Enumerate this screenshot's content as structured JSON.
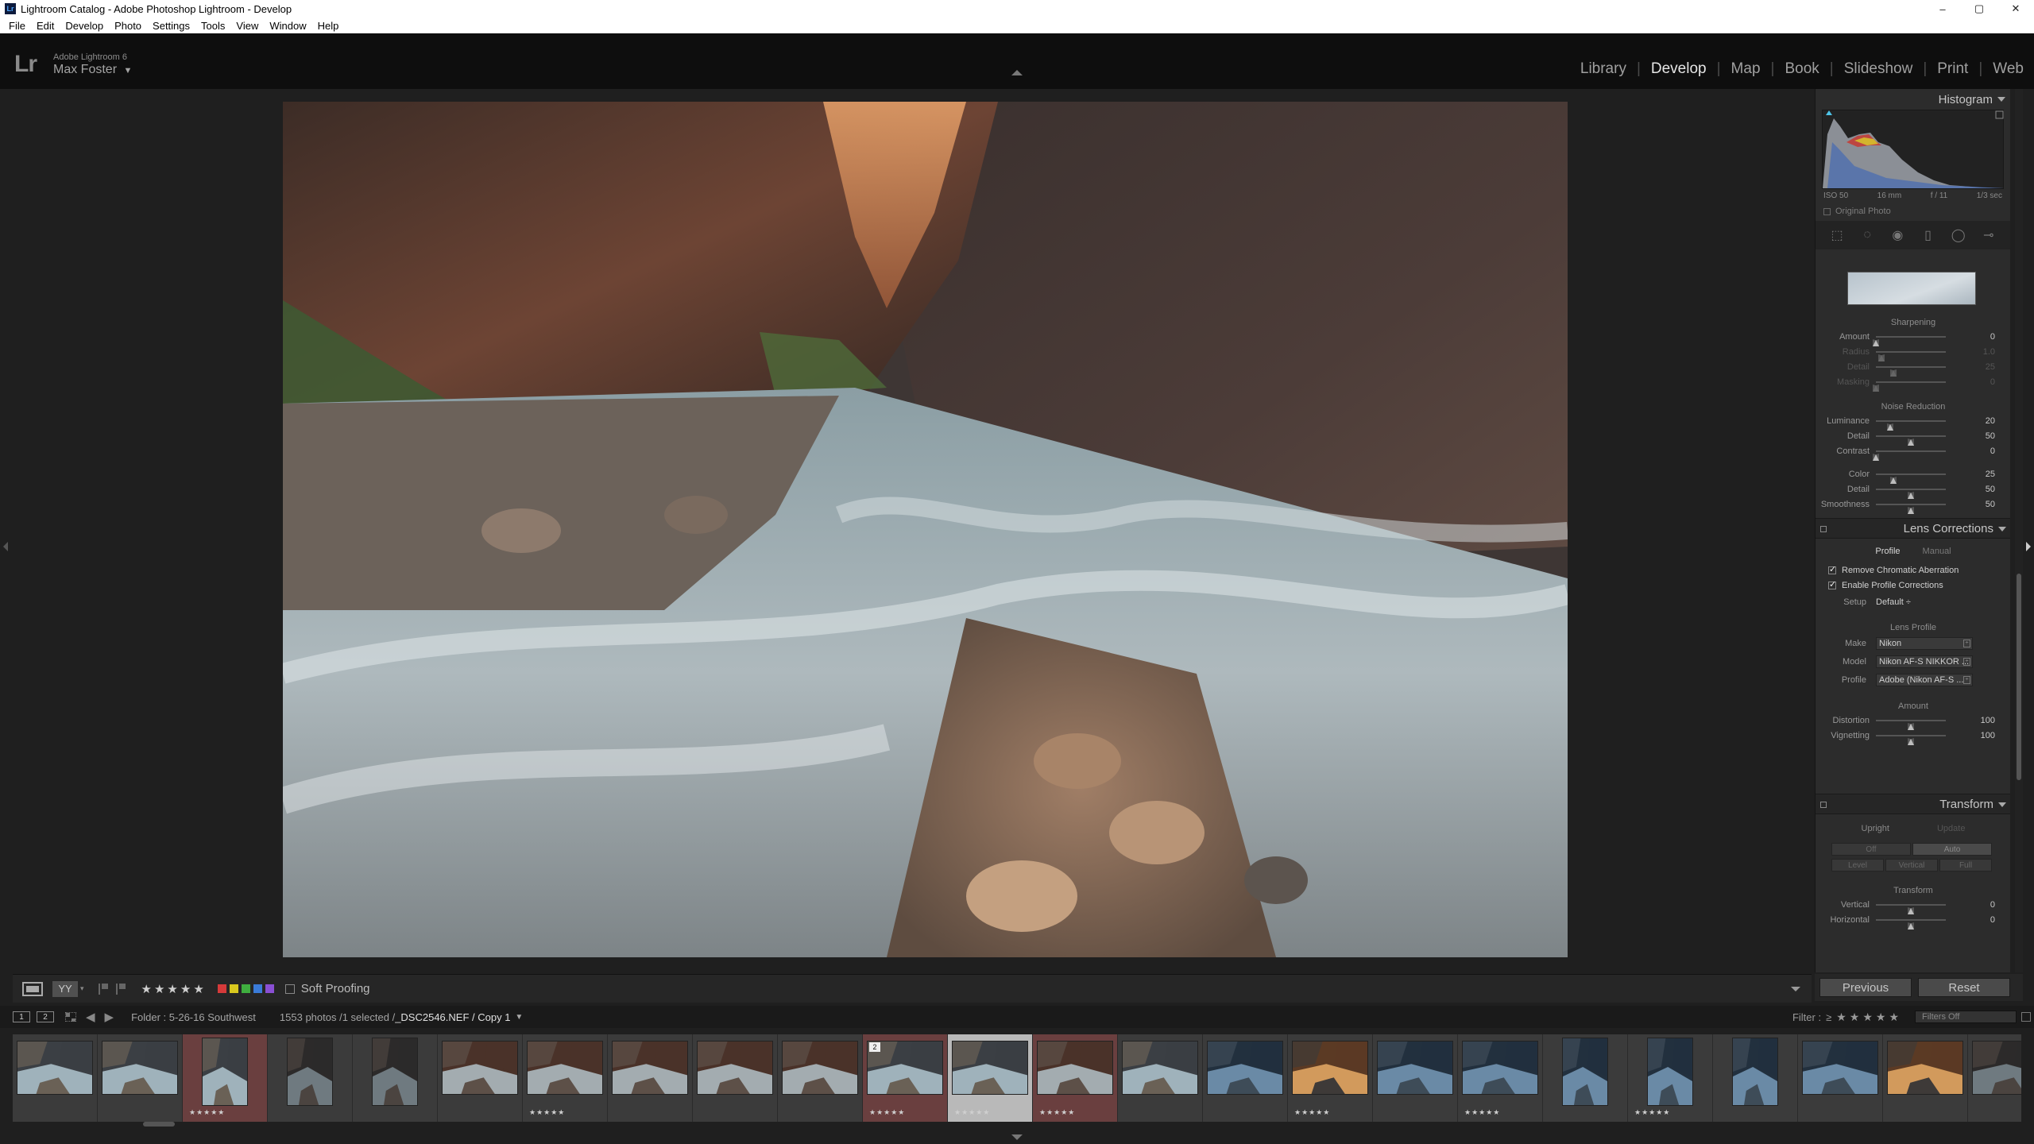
{
  "window": {
    "title": "Lightroom Catalog - Adobe Photoshop Lightroom - Develop",
    "controls": [
      "–",
      "▢",
      "✕"
    ]
  },
  "menu": [
    "File",
    "Edit",
    "Develop",
    "Photo",
    "Settings",
    "Tools",
    "View",
    "Window",
    "Help"
  ],
  "identity": {
    "logo": "Lr",
    "app_name": "Adobe Lightroom 6",
    "user": "Max Foster",
    "user_arrow": "▼"
  },
  "modules": [
    "Library",
    "Develop",
    "Map",
    "Book",
    "Slideshow",
    "Print",
    "Web"
  ],
  "active_module": "Develop",
  "toolbar": {
    "view_yy": "YY",
    "stars": "★★★★★",
    "label_colors": [
      "#d63a3a",
      "#d9c81e",
      "#3fae3f",
      "#3a7bd8",
      "#8a4fd4"
    ],
    "soft_proofing": "Soft Proofing"
  },
  "histogram": {
    "title": "Histogram",
    "iso": "ISO 50",
    "focal": "16 mm",
    "aperture": "f / 11",
    "shutter": "1/3 sec",
    "original_photo": "Original Photo"
  },
  "detail": {
    "sharpening_title": "Sharpening",
    "sharpening": [
      {
        "label": "Amount",
        "value": "0",
        "pos": 0.0,
        "dim": false
      },
      {
        "label": "Radius",
        "value": "1.0",
        "pos": 0.08,
        "dim": true
      },
      {
        "label": "Detail",
        "value": "25",
        "pos": 0.25,
        "dim": true
      },
      {
        "label": "Masking",
        "value": "0",
        "pos": 0.0,
        "dim": true
      }
    ],
    "noise_title": "Noise Reduction",
    "noise": [
      {
        "label": "Luminance",
        "value": "20",
        "pos": 0.2,
        "dim": false
      },
      {
        "label": "Detail",
        "value": "50",
        "pos": 0.5,
        "dim": false
      },
      {
        "label": "Contrast",
        "value": "0",
        "pos": 0.0,
        "dim": false
      }
    ],
    "color_noise": [
      {
        "label": "Color",
        "value": "25",
        "pos": 0.25,
        "dim": false
      },
      {
        "label": "Detail",
        "value": "50",
        "pos": 0.5,
        "dim": false
      },
      {
        "label": "Smoothness",
        "value": "50",
        "pos": 0.5,
        "dim": false
      }
    ]
  },
  "lens": {
    "title": "Lens Corrections",
    "tab_profile": "Profile",
    "tab_manual": "Manual",
    "chk_ca": "Remove Chromatic Aberration",
    "chk_profile": "Enable Profile Corrections",
    "setup_label": "Setup",
    "setup_value": "Default ÷",
    "lens_profile_title": "Lens Profile",
    "make_label": "Make",
    "make_value": "Nikon",
    "model_label": "Model",
    "model_value": "Nikon AF-S NIKKOR ...",
    "profile_label": "Profile",
    "profile_value": "Adobe (Nikon AF-S ...",
    "amount_title": "Amount",
    "amount": [
      {
        "label": "Distortion",
        "value": "100",
        "pos": 0.5,
        "dim": false
      },
      {
        "label": "Vignetting",
        "value": "100",
        "pos": 0.5,
        "dim": false
      }
    ]
  },
  "transform": {
    "title": "Transform",
    "upright": "Upright",
    "update": "Update",
    "buttons": [
      "Off",
      "Auto",
      "Level",
      "Vertical",
      "Full"
    ],
    "transform_title": "Transform",
    "sliders": [
      {
        "label": "Vertical",
        "value": "0",
        "pos": 0.5,
        "dim": false
      },
      {
        "label": "Horizontal",
        "value": "0",
        "pos": 0.5,
        "dim": false
      }
    ]
  },
  "bottom_buttons": {
    "previous": "Previous",
    "reset": "Reset"
  },
  "filmstrip_header": {
    "screen1": "1",
    "screen2": "2",
    "source": "Folder : 5-26-16 Southwest",
    "count": "1553 photos /1 selected /",
    "filename": "_DSC2546.NEF / Copy 1",
    "filter_label": "Filter :",
    "filter_op": "≥",
    "filter_stars": "★★★★★",
    "filter_value": "Filters Off"
  },
  "filmstrip": [
    {
      "kind": "h",
      "tone": "river",
      "stars": "",
      "hl": false,
      "cur": false
    },
    {
      "kind": "h",
      "tone": "river",
      "stars": "",
      "hl": false,
      "cur": false
    },
    {
      "kind": "v",
      "tone": "river",
      "stars": "★★★★★",
      "hl": true,
      "cur": false
    },
    {
      "kind": "v",
      "tone": "dark",
      "stars": "",
      "hl": false,
      "cur": false
    },
    {
      "kind": "v",
      "tone": "dark",
      "stars": "",
      "hl": false,
      "cur": false
    },
    {
      "kind": "h",
      "tone": "canyon",
      "stars": "",
      "hl": false,
      "cur": false
    },
    {
      "kind": "h",
      "tone": "canyon",
      "stars": "★★★★★",
      "hl": false,
      "cur": false
    },
    {
      "kind": "h",
      "tone": "canyon",
      "stars": "",
      "hl": false,
      "cur": false
    },
    {
      "kind": "h",
      "tone": "canyon",
      "stars": "",
      "hl": false,
      "cur": false
    },
    {
      "kind": "h",
      "tone": "canyon",
      "stars": "",
      "hl": false,
      "cur": false
    },
    {
      "kind": "h",
      "tone": "river",
      "stars": "★★★★★",
      "hl": true,
      "cur": false,
      "badge": "2"
    },
    {
      "kind": "h",
      "tone": "river",
      "stars": "★★★★★",
      "hl": false,
      "cur": true
    },
    {
      "kind": "h",
      "tone": "canyon",
      "stars": "★★★★★",
      "hl": true,
      "cur": false
    },
    {
      "kind": "h",
      "tone": "river",
      "stars": "",
      "hl": false,
      "cur": false
    },
    {
      "kind": "h",
      "tone": "blue",
      "stars": "",
      "hl": false,
      "cur": false
    },
    {
      "kind": "h",
      "tone": "warm",
      "stars": "★★★★★",
      "hl": false,
      "cur": false
    },
    {
      "kind": "h",
      "tone": "blue",
      "stars": "",
      "hl": false,
      "cur": false
    },
    {
      "kind": "h",
      "tone": "blue",
      "stars": "★★★★★",
      "hl": false,
      "cur": false
    },
    {
      "kind": "v",
      "tone": "blue",
      "stars": "",
      "hl": false,
      "cur": false
    },
    {
      "kind": "v",
      "tone": "blue",
      "stars": "★★★★★",
      "hl": false,
      "cur": false
    },
    {
      "kind": "v",
      "tone": "blue",
      "stars": "",
      "hl": false,
      "cur": false
    },
    {
      "kind": "h",
      "tone": "blue",
      "stars": "",
      "hl": false,
      "cur": false
    },
    {
      "kind": "h",
      "tone": "warm",
      "stars": "",
      "hl": false,
      "cur": false
    },
    {
      "kind": "h",
      "tone": "dark",
      "stars": "",
      "hl": false,
      "cur": false
    }
  ]
}
